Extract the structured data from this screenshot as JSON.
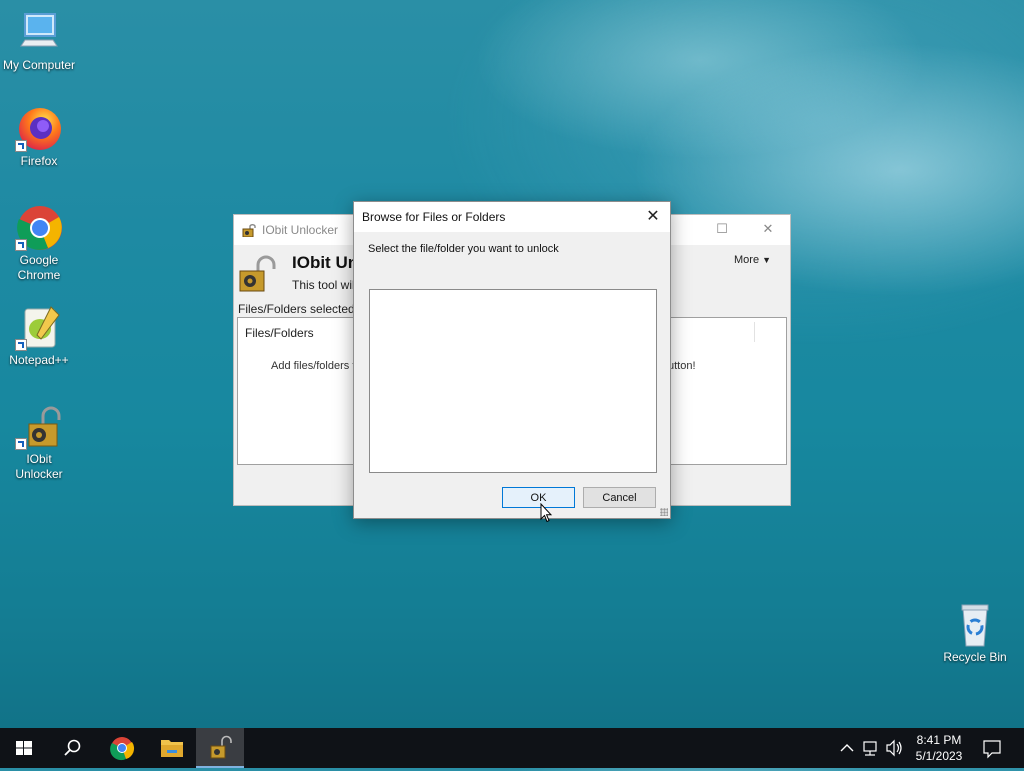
{
  "desktop": {
    "icons": [
      {
        "label": "My Computer"
      },
      {
        "label": "Firefox"
      },
      {
        "label": "Google Chrome"
      },
      {
        "label": "Notepad++"
      },
      {
        "label": "IObit Unlocker"
      },
      {
        "label": "Recycle Bin"
      }
    ]
  },
  "bg_window": {
    "title": "IObit Unlocker",
    "header_title": "IObit Un",
    "header_sub": "This tool will",
    "more_label": "More",
    "selected_label": "Files/Folders selected",
    "column_header": "Files/Folders",
    "hint_left": "Add files/folders t",
    "hint_right": "utton!"
  },
  "dialog": {
    "title": "Browse for Files or Folders",
    "prompt": "Select the file/folder you want to unlock",
    "ok_label": "OK",
    "cancel_label": "Cancel"
  },
  "taskbar": {
    "time": "8:41 PM",
    "date": "5/1/2023"
  },
  "colors": {
    "accent": "#0078d7",
    "taskbar": "#0f1217"
  }
}
